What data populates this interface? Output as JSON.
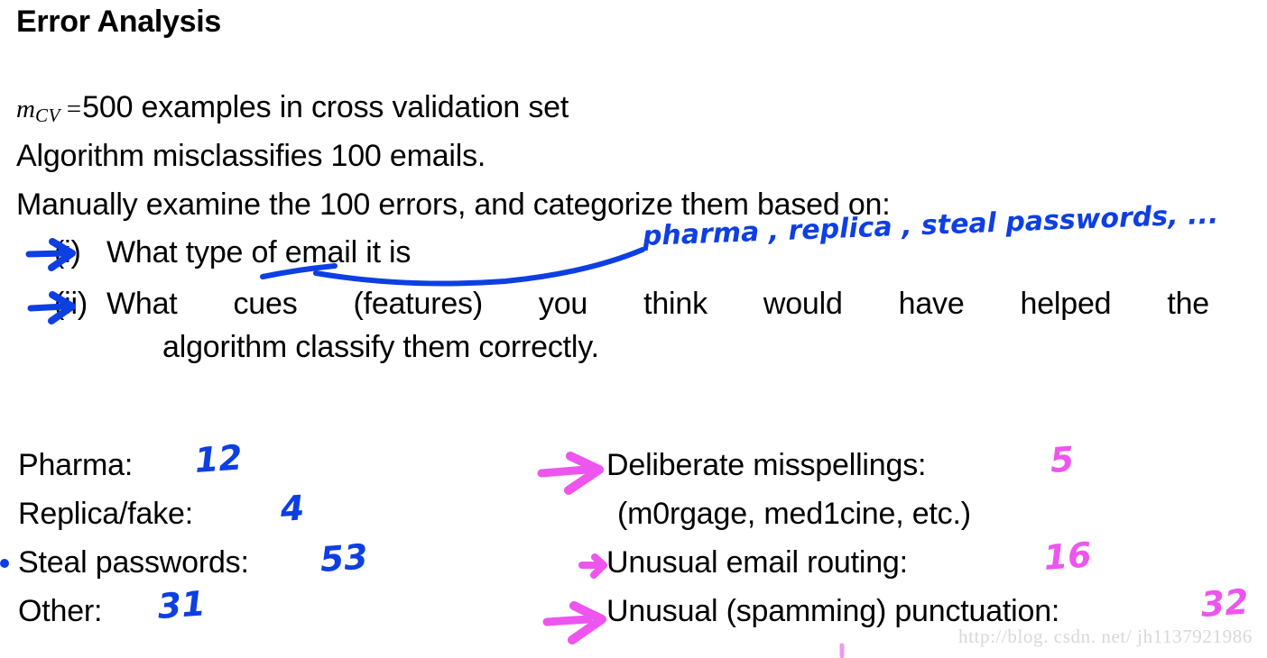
{
  "slide": {
    "title": "Error Analysis",
    "background_color": "#ffffff",
    "text_color": "#000000"
  },
  "ink_colors": {
    "blue": "#0d3fe3",
    "magenta": "#ee55ee",
    "watermark_gray": "#d8d8d8"
  },
  "body": {
    "math_variable": "m",
    "math_subscript": "CV",
    "math_equals": "=",
    "mcv_line": "500 examples in cross validation set",
    "algorithm_line": "Algorithm misclassifies 100 emails.",
    "manual_line": "Manually examine the 100 errors, and categorize them based on:"
  },
  "items": [
    {
      "label": "(i)",
      "text": "What type of email it is"
    },
    {
      "label": "(ii)",
      "text": "What cues (features) you think would have helped the",
      "continuation": "algorithm classify them correctly."
    }
  ],
  "annotations": {
    "type_of_email_handwriting": "pharma , replica , steal passwords, ..."
  },
  "categories_left": [
    {
      "label": "Pharma:",
      "count": "12"
    },
    {
      "label": "Replica/fake:",
      "count": "4"
    },
    {
      "label": "Steal passwords:",
      "count": "53"
    },
    {
      "label": "Other:",
      "count": "31"
    }
  ],
  "cues_right": [
    {
      "label": "Deliberate misspellings:",
      "count": "5"
    },
    {
      "label": "(m0rgage, med1cine, etc.)",
      "count": ""
    },
    {
      "label": "Unusual email routing:",
      "count": "16"
    },
    {
      "label": "Unusual (spamming) punctuation:",
      "count": "32"
    }
  ],
  "watermark": "http://blog. csdn. net/ jh1137921986"
}
